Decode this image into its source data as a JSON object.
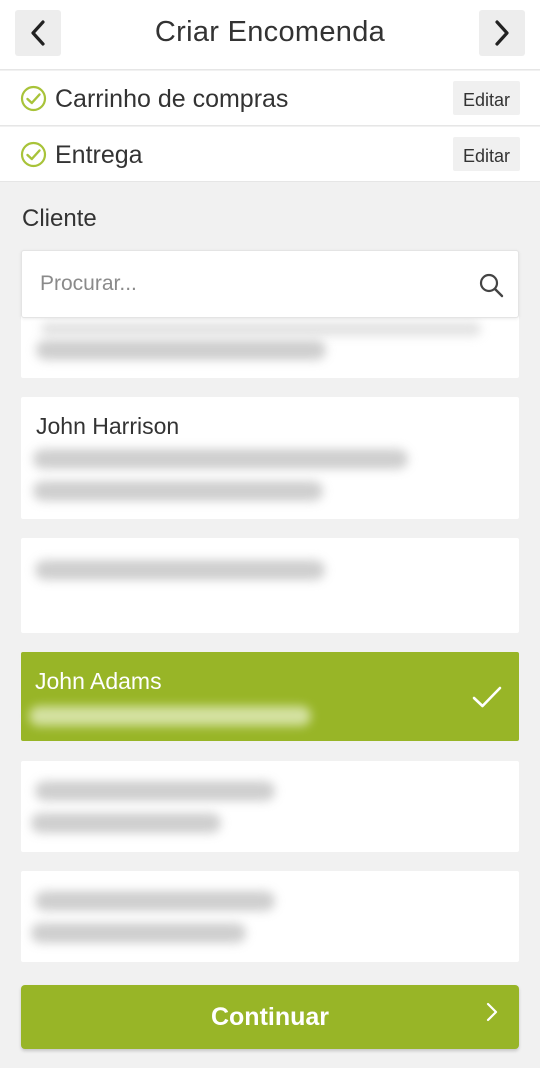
{
  "header": {
    "title": "Criar Encomenda",
    "back_icon": "chevron-left-icon",
    "forward_icon": "chevron-right-icon"
  },
  "steps": [
    {
      "label": "Carrinho de compras",
      "action": "Editar",
      "status": "completed"
    },
    {
      "label": "Entrega",
      "action": "Editar",
      "status": "completed"
    }
  ],
  "customer": {
    "section_label": "Cliente",
    "search": {
      "placeholder": "Procurar...",
      "value": ""
    },
    "list": [
      {
        "name": "",
        "selected": false,
        "details_redacted": true
      },
      {
        "name": "John Harrison",
        "selected": false,
        "details_redacted": true
      },
      {
        "name": "",
        "selected": false,
        "details_redacted": true
      },
      {
        "name": "John Adams",
        "selected": true,
        "details_redacted": true
      },
      {
        "name": "",
        "selected": false,
        "details_redacted": true
      },
      {
        "name": "",
        "selected": false,
        "details_redacted": true
      }
    ]
  },
  "footer": {
    "continue_label": "Continuar"
  },
  "colors": {
    "accent": "#98b527",
    "check_circle": "#a8c339",
    "background": "#f1f1f1",
    "text": "#333333"
  }
}
